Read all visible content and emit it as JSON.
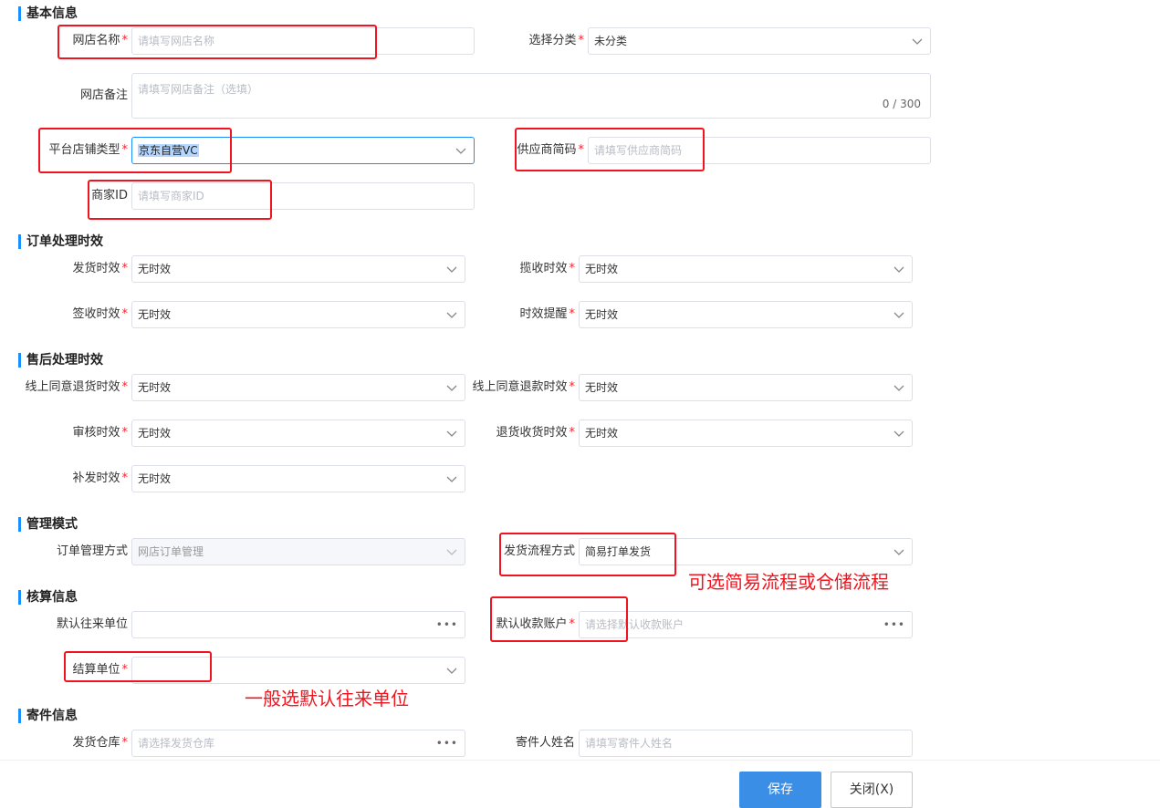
{
  "sections": {
    "basic": "基本信息",
    "order": "订单处理时效",
    "aftersale": "售后处理时效",
    "mode": "管理模式",
    "account": "核算信息",
    "shipping": "寄件信息"
  },
  "basic": {
    "shop_name_label": "网店名称",
    "shop_name_placeholder": "请填写网店名称",
    "category_label": "选择分类",
    "category_value": "未分类",
    "remark_label": "网店备注",
    "remark_placeholder": "请填写网店备注（选填）",
    "remark_counter": "0 / 300",
    "platform_type_label": "平台店铺类型",
    "platform_type_value": "京东自营VC",
    "supplier_code_label": "供应商简码",
    "supplier_code_placeholder": "请填写供应商简码",
    "merchant_id_label": "商家ID",
    "merchant_id_placeholder": "请填写商家ID"
  },
  "order": {
    "ship_time_label": "发货时效",
    "ship_time_value": "无时效",
    "pickup_time_label": "揽收时效",
    "pickup_time_value": "无时效",
    "sign_time_label": "签收时效",
    "sign_time_value": "无时效",
    "reminder_label": "时效提醒",
    "reminder_value": "无时效"
  },
  "aftersale": {
    "return_agree_label": "线上同意退货时效",
    "return_agree_value": "无时效",
    "refund_agree_label": "线上同意退款时效",
    "refund_agree_value": "无时效",
    "audit_label": "审核时效",
    "audit_value": "无时效",
    "return_receive_label": "退货收货时效",
    "return_receive_value": "无时效",
    "reissue_label": "补发时效",
    "reissue_value": "无时效"
  },
  "mode": {
    "order_mgmt_label": "订单管理方式",
    "order_mgmt_value": "网店订单管理",
    "ship_flow_label": "发货流程方式",
    "ship_flow_value": "简易打单发货"
  },
  "account": {
    "default_unit_label": "默认往来单位",
    "default_unit_value": "",
    "default_account_label": "默认收款账户",
    "default_account_placeholder": "请选择默认收款账户",
    "settle_unit_label": "结算单位",
    "settle_unit_value": ""
  },
  "shipping": {
    "warehouse_label": "发货仓库",
    "warehouse_placeholder": "请选择发货仓库",
    "sender_name_label": "寄件人姓名",
    "sender_name_placeholder": "请填写寄件人姓名"
  },
  "annotations": {
    "flow_note": "可选简易流程或仓储流程",
    "settle_note": "一般选默认往来单位"
  },
  "footer": {
    "save_label": "保存",
    "close_label": "关闭(X)"
  },
  "icons": {
    "dropdown": "chevron-down-icon",
    "more": "more-dots-icon"
  },
  "colors": {
    "accent": "#1890ff",
    "required": "#f5222d",
    "annotation": "#f0141e",
    "primary_button": "#3a8ee6"
  }
}
